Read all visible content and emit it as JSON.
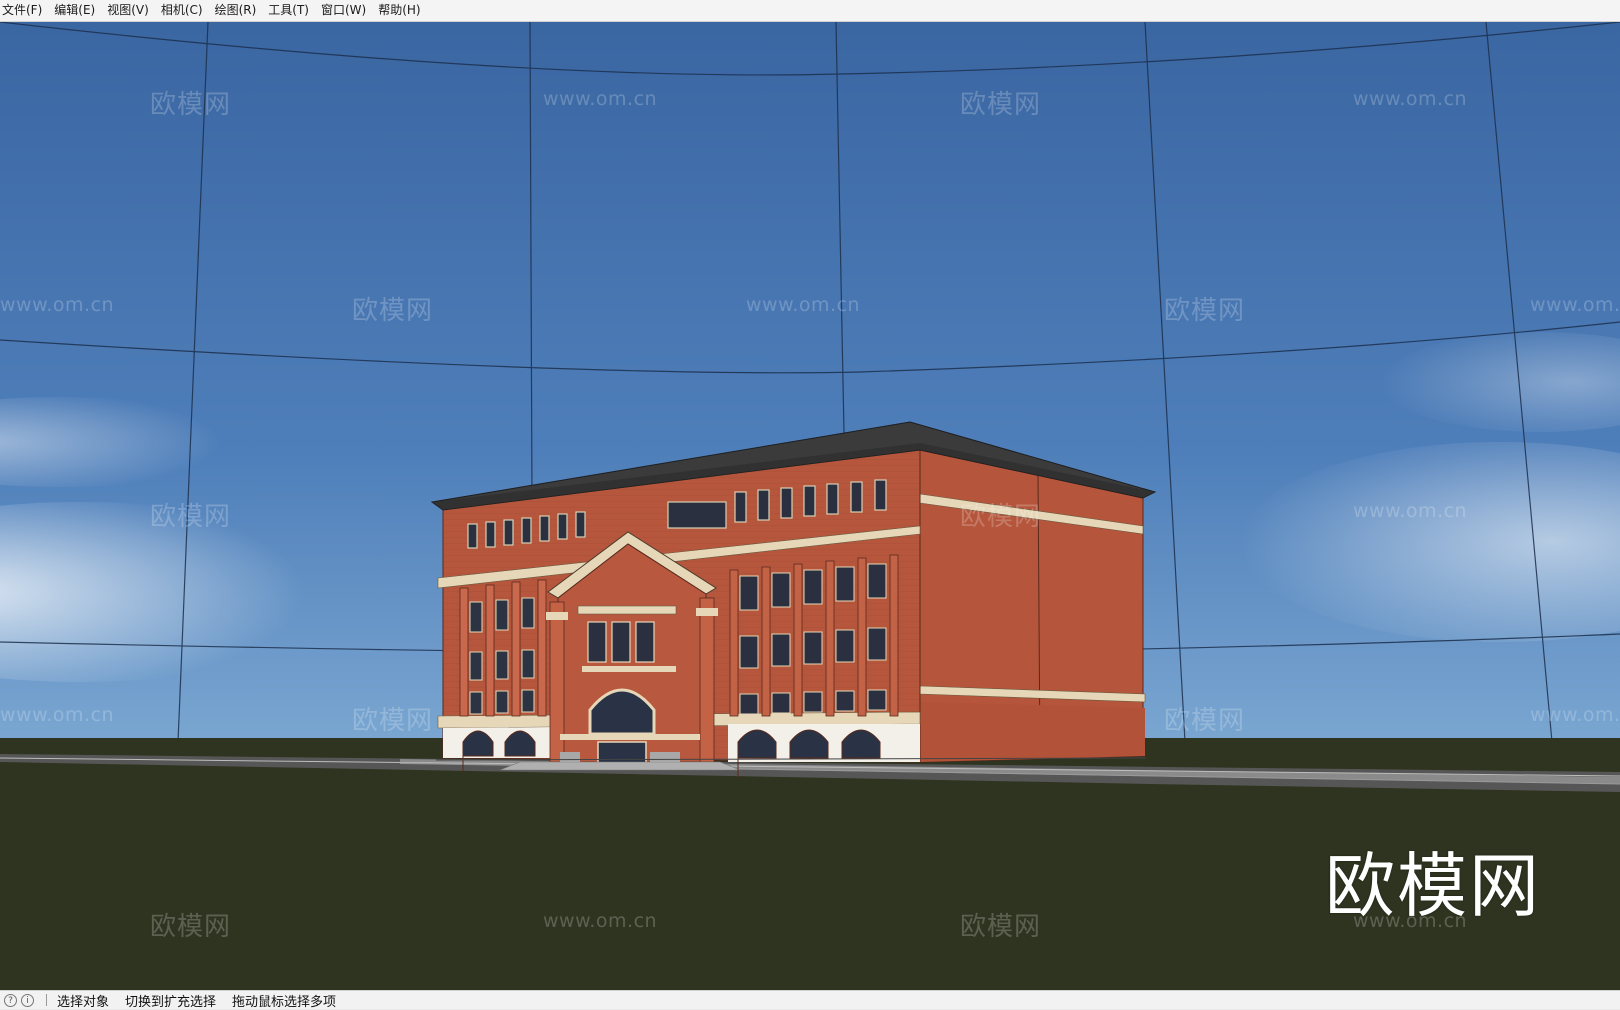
{
  "menu": {
    "items": [
      "文件(F)",
      "编辑(E)",
      "视图(V)",
      "相机(C)",
      "绘图(R)",
      "工具(T)",
      "窗口(W)",
      "帮助(H)"
    ]
  },
  "watermark": {
    "logo_text": "欧模网",
    "url_text": "www.om.cn"
  },
  "big_logo": "欧模网",
  "status": {
    "hint_select": "选择对象",
    "hint_toggle": "切换到扩充选择",
    "hint_drag": "拖动鼠标选择多项"
  },
  "colors": {
    "sky_top": "#3d6aa6",
    "sky_bottom": "#6d9ccc",
    "ground": "#2e3420",
    "brick": "#b8583f",
    "roof": "#3a3a3a",
    "trim": "#e6d7b8"
  }
}
